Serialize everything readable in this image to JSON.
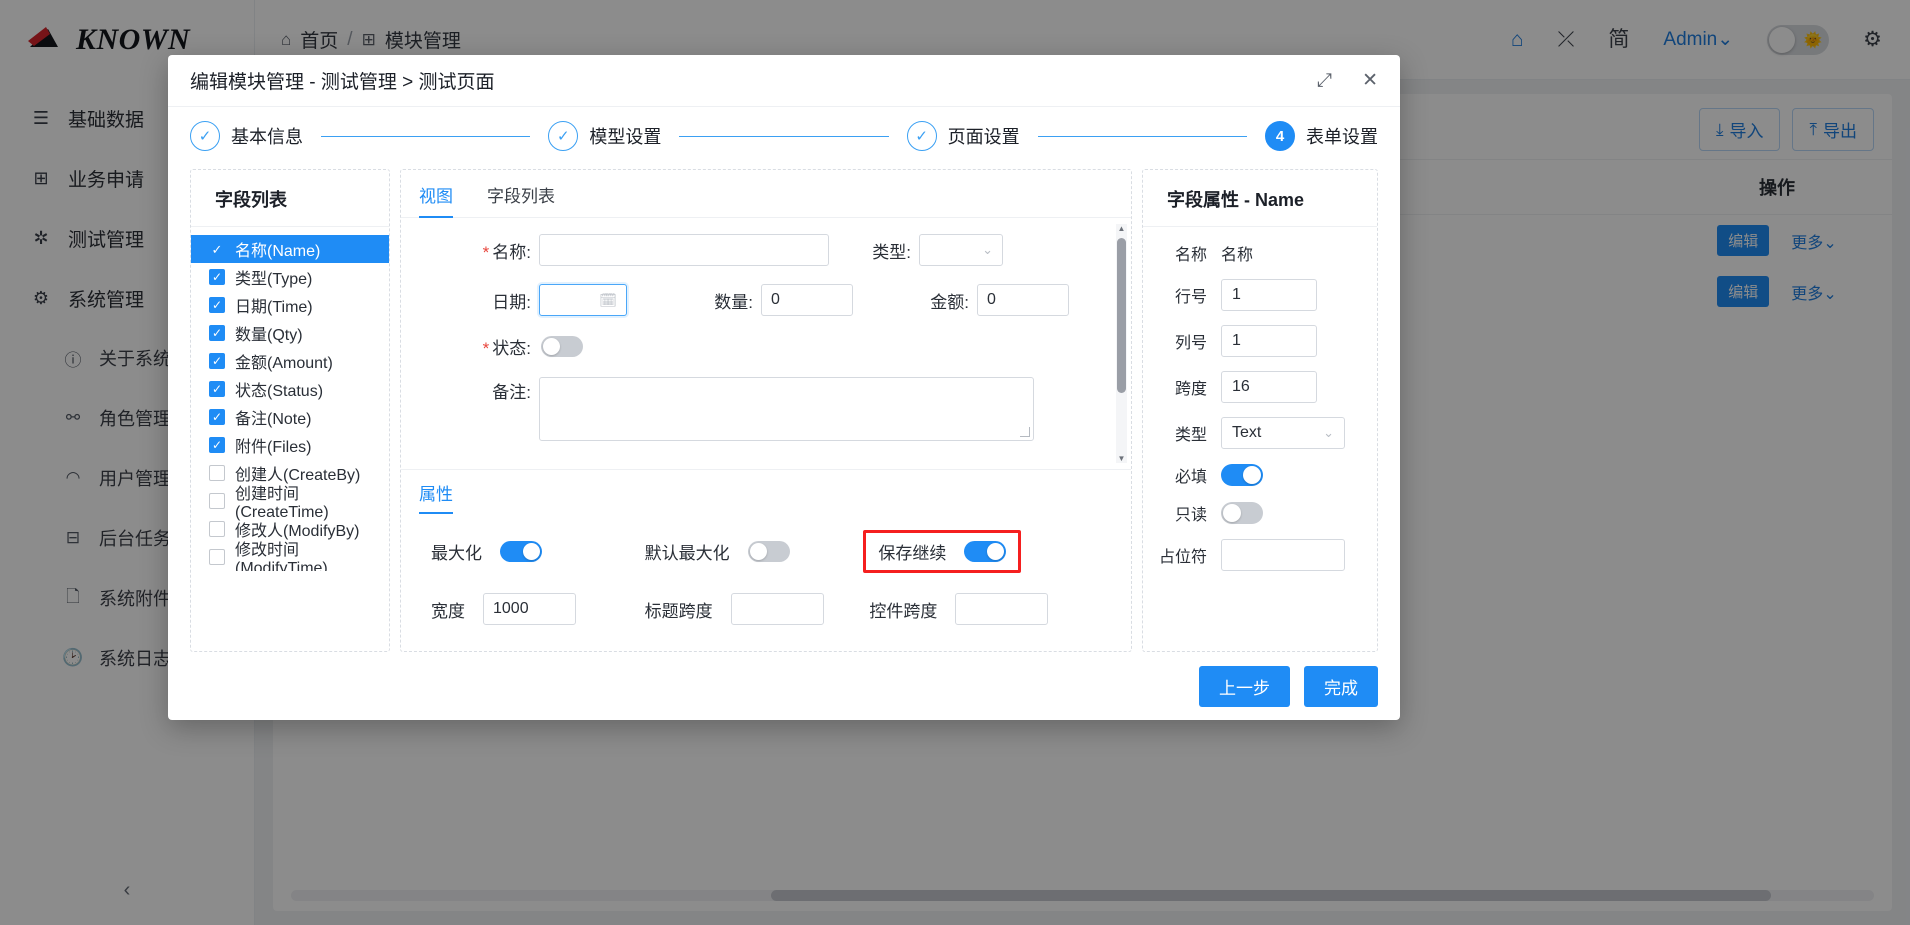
{
  "app": {
    "brand": "KNOWN",
    "sidebar": {
      "items": [
        {
          "icon": "list-icon",
          "label": "基础数据"
        },
        {
          "icon": "grid-icon",
          "label": "业务申请"
        },
        {
          "icon": "bug-icon",
          "label": "测试管理"
        },
        {
          "icon": "gear-icon",
          "label": "系统管理"
        }
      ],
      "subitems": [
        {
          "icon": "info-icon",
          "label": "关于系统"
        },
        {
          "icon": "role-icon",
          "label": "角色管理"
        },
        {
          "icon": "user-icon",
          "label": "用户管理"
        },
        {
          "icon": "task-icon",
          "label": "后台任务"
        },
        {
          "icon": "file-icon",
          "label": "系统附件"
        },
        {
          "icon": "clock-icon",
          "label": "系统日志"
        }
      ],
      "collapse": "‹"
    },
    "topbar": {
      "breadcrumb": [
        {
          "icon": "home-icon",
          "label": "首页"
        },
        {
          "icon": "module-icon",
          "label": "模块管理"
        }
      ],
      "separator": "/",
      "icons": {
        "home": "⌂",
        "fullscreen": "⤫",
        "language": "简",
        "gear": "⚙",
        "sun": "🌞"
      },
      "user": "Admin",
      "user_caret": "⌄"
    },
    "page": {
      "import_label": "导入",
      "export_label": "导出",
      "ops_header": "操作",
      "rows": [
        {
          "edit": "编辑",
          "more": "更多"
        },
        {
          "edit": "编辑",
          "more": "更多"
        }
      ],
      "more_caret": "⌄"
    }
  },
  "modal": {
    "title": "编辑模块管理 - 测试管理 > 测试页面",
    "maximize_icon": "⤢",
    "close_icon": "✕",
    "steps": [
      {
        "mark": "✓",
        "label": "基本信息",
        "active": false
      },
      {
        "mark": "✓",
        "label": "模型设置",
        "active": false
      },
      {
        "mark": "✓",
        "label": "页面设置",
        "active": false
      },
      {
        "mark": "4",
        "label": "表单设置",
        "active": true
      }
    ],
    "field_panel": {
      "title": "字段列表",
      "items": [
        {
          "label": "名称(Name)",
          "checked": true,
          "selected": true
        },
        {
          "label": "类型(Type)",
          "checked": true,
          "selected": false
        },
        {
          "label": "日期(Time)",
          "checked": true,
          "selected": false
        },
        {
          "label": "数量(Qty)",
          "checked": true,
          "selected": false
        },
        {
          "label": "金额(Amount)",
          "checked": true,
          "selected": false
        },
        {
          "label": "状态(Status)",
          "checked": true,
          "selected": false
        },
        {
          "label": "备注(Note)",
          "checked": true,
          "selected": false
        },
        {
          "label": "附件(Files)",
          "checked": true,
          "selected": false
        },
        {
          "label": "创建人(CreateBy)",
          "checked": false,
          "selected": false
        },
        {
          "label": "创建时间(CreateTime)",
          "checked": false,
          "selected": false
        },
        {
          "label": "修改人(ModifyBy)",
          "checked": false,
          "selected": false
        },
        {
          "label": "修改时间(ModifyTime)",
          "checked": false,
          "selected": false
        }
      ]
    },
    "center": {
      "tabs": [
        {
          "label": "视图",
          "active": true
        },
        {
          "label": "字段列表",
          "active": false
        }
      ],
      "preview": {
        "name_label": "名称:",
        "name_value": "",
        "type_label": "类型:",
        "type_value": "",
        "date_label": "日期:",
        "date_value": "",
        "qty_label": "数量:",
        "qty_value": "0",
        "amount_label": "金额:",
        "amount_value": "0",
        "status_label": "状态:",
        "status_on": false,
        "note_label": "备注:",
        "note_value": "",
        "required_mark": "*",
        "calendar_icon": "▭",
        "caret_icon": "⌄"
      },
      "attributes": {
        "tab_label": "属性",
        "maximize_label": "最大化",
        "maximize_on": true,
        "default_maximize_label": "默认最大化",
        "default_maximize_on": false,
        "save_continue_label": "保存继续",
        "save_continue_on": true,
        "save_continue_highlighted": true,
        "width_label": "宽度",
        "width_value": "1000",
        "title_span_label": "标题跨度",
        "title_span_value": "",
        "control_span_label": "控件跨度",
        "control_span_value": ""
      }
    },
    "properties": {
      "title": "字段属性 - Name",
      "name_label": "名称",
      "name_value": "名称",
      "row_label": "行号",
      "row_value": "1",
      "col_label": "列号",
      "col_value": "1",
      "span_label": "跨度",
      "span_value": "16",
      "type_label": "类型",
      "type_value": "Text",
      "type_caret": "⌄",
      "required_label": "必填",
      "required_on": true,
      "readonly_label": "只读",
      "readonly_on": false,
      "placeholder_label": "占位符",
      "placeholder_value": ""
    },
    "footer": {
      "prev_label": "上一步",
      "finish_label": "完成"
    }
  },
  "colors": {
    "primary": "#1f8cf5",
    "link": "#1f7fe0",
    "highlight": "#f51f1f",
    "required": "#e8453c"
  }
}
